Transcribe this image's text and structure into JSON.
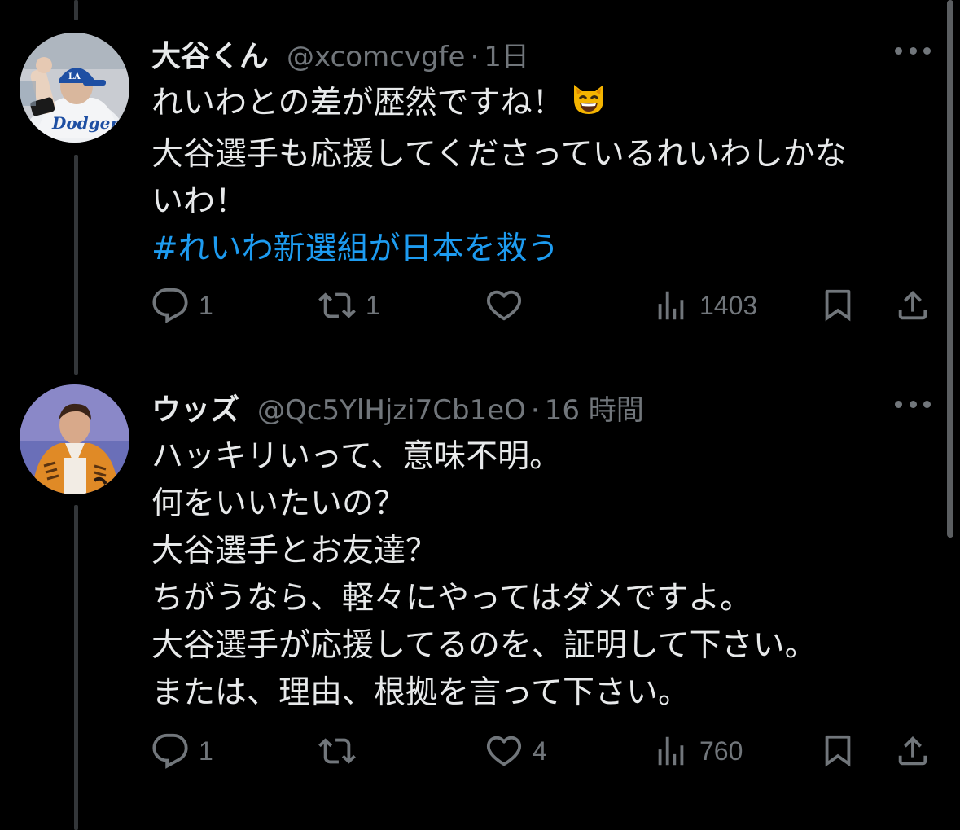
{
  "tweets": [
    {
      "display_name": "大谷くん",
      "handle": "@xcomcvgfe",
      "separator": "·",
      "time": "1日",
      "avatar": "baseball-player-avatar",
      "avatar_jersey_text": "Dodgers",
      "text_lines": [
        "れいわとの差が歴然ですね！",
        "大谷選手も応援してくださっているれいわしかな",
        "いわ！"
      ],
      "emoji": "grinning-cat-emoji",
      "hashtag": "#れいわ新選組が日本を救う",
      "replies": "1",
      "reposts": "1",
      "likes": "",
      "views": "1403"
    },
    {
      "display_name": "ウッズ",
      "handle": "@Qc5YlHjzi7Cb1eO",
      "separator": "·",
      "time": "16 時間",
      "avatar": "man-in-orange-jacket-avatar",
      "text_lines": [
        "ハッキリいって、意味不明。",
        "何をいいたいの？",
        "大谷選手とお友達？",
        "ちがうなら、軽々にやってはダメですよ。",
        "大谷選手が応援してるのを、証明して下さい。",
        "または、理由、根拠を言って下さい。"
      ],
      "replies": "1",
      "reposts": "",
      "likes": "4",
      "views": "760"
    }
  ],
  "icons": {
    "reply": "reply-icon",
    "repost": "repost-icon",
    "like": "heart-icon",
    "views": "views-icon",
    "bookmark": "bookmark-icon",
    "share": "share-icon",
    "more": "more-icon"
  },
  "colors": {
    "background": "#000000",
    "primary_text": "#e7e9ea",
    "secondary_text": "#71767b",
    "link": "#1d9bf0",
    "thread_line": "#333639"
  }
}
